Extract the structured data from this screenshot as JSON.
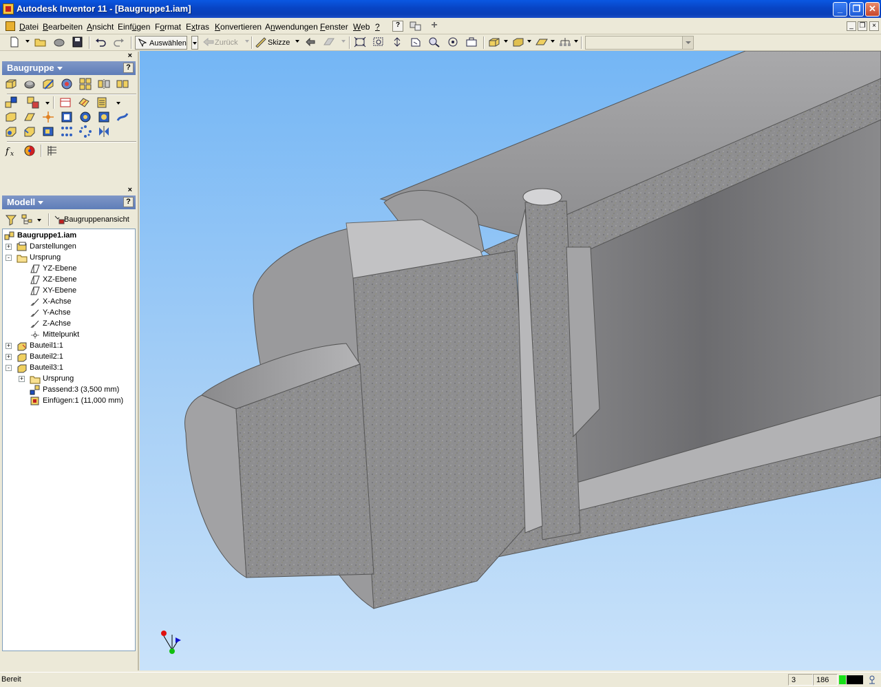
{
  "window": {
    "title": "Autodesk Inventor 11 - [Baugruppe1.iam]"
  },
  "menu": {
    "items": [
      {
        "pre": "",
        "u": "D",
        "post": "atei"
      },
      {
        "pre": "",
        "u": "B",
        "post": "earbeiten"
      },
      {
        "pre": "",
        "u": "A",
        "post": "nsicht"
      },
      {
        "pre": "Einf",
        "u": "ü",
        "post": "gen"
      },
      {
        "pre": "F",
        "u": "o",
        "post": "rmat"
      },
      {
        "pre": "E",
        "u": "x",
        "post": "tras"
      },
      {
        "pre": "",
        "u": "K",
        "post": "onvertieren"
      },
      {
        "pre": "A",
        "u": "n",
        "post": "wendungen"
      },
      {
        "pre": "",
        "u": "F",
        "post": "enster"
      },
      {
        "pre": "",
        "u": "W",
        "post": "eb"
      },
      {
        "pre": "",
        "u": "?",
        "post": ""
      }
    ]
  },
  "toolbar": {
    "select_label": "Auswählen",
    "back_label": "Zurück",
    "sketch_label": "Skizze"
  },
  "assembly_panel": {
    "title": "Baugruppe",
    "help": "?",
    "close": "×"
  },
  "model_panel": {
    "title": "Modell",
    "help": "?",
    "close": "×",
    "view_label": "Baugruppenansicht"
  },
  "tree": {
    "nodes": [
      {
        "label": "Baugruppe1.iam",
        "icon": "assembly-icon",
        "bold": true
      },
      {
        "label": "Darstellungen",
        "icon": "representations-icon"
      },
      {
        "label": "Ursprung",
        "icon": "folder-open-icon"
      },
      {
        "label": "YZ-Ebene",
        "icon": "plane-icon"
      },
      {
        "label": "XZ-Ebene",
        "icon": "plane-icon"
      },
      {
        "label": "XY-Ebene",
        "icon": "plane-icon"
      },
      {
        "label": "X-Achse",
        "icon": "axis-icon"
      },
      {
        "label": "Y-Achse",
        "icon": "axis-icon"
      },
      {
        "label": "Z-Achse",
        "icon": "axis-icon"
      },
      {
        "label": "Mittelpunkt",
        "icon": "point-icon"
      },
      {
        "label": "Bauteil1:1",
        "icon": "grounded-part-icon"
      },
      {
        "label": "Bauteil2:1",
        "icon": "part-icon"
      },
      {
        "label": "Bauteil3:1",
        "icon": "part-icon"
      },
      {
        "label": "Ursprung",
        "icon": "folder-icon"
      },
      {
        "label": "Passend:3 (3,500 mm)",
        "icon": "mate-constraint-icon"
      },
      {
        "label": "Einfügen:1 (11,000 mm)",
        "icon": "insert-constraint-icon"
      }
    ]
  },
  "status": {
    "text": "Bereit",
    "box1": "3",
    "box2": "186"
  },
  "colors": {
    "title_blue": "#0a58e2",
    "panel_header": "#6b86bf",
    "viewport_top": "#74b6f5",
    "viewport_bottom": "#c9e2fa"
  }
}
